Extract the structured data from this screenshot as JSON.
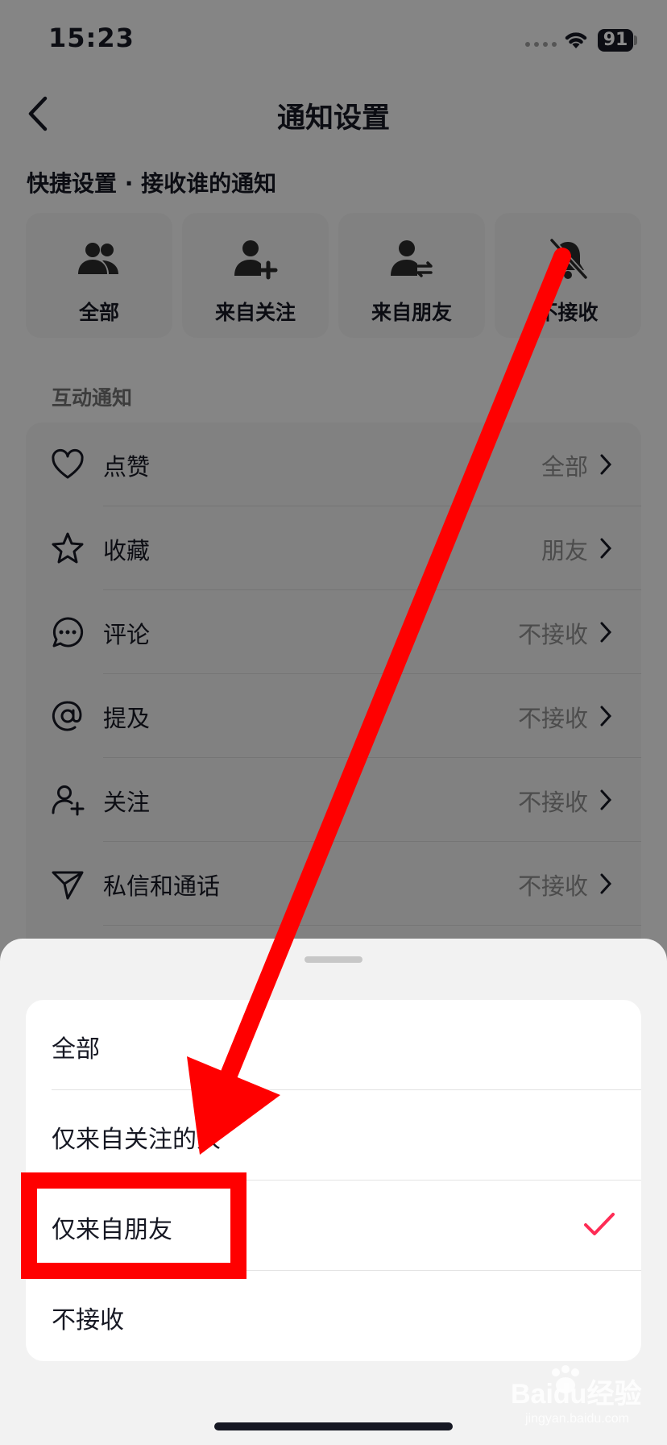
{
  "status": {
    "time": "15:23",
    "battery": "91"
  },
  "header": {
    "title": "通知设置"
  },
  "quick": {
    "title": "快捷设置 · 接收谁的通知",
    "cards": [
      {
        "label": "全部",
        "icon": "people-icon"
      },
      {
        "label": "来自关注",
        "icon": "person-add-icon"
      },
      {
        "label": "来自朋友",
        "icon": "person-swap-icon"
      },
      {
        "label": "不接收",
        "icon": "bell-off-icon"
      }
    ]
  },
  "interaction": {
    "title": "互动通知",
    "rows": [
      {
        "label": "点赞",
        "value": "全部",
        "icon": "heart-icon"
      },
      {
        "label": "收藏",
        "value": "朋友",
        "icon": "star-icon"
      },
      {
        "label": "评论",
        "value": "不接收",
        "icon": "comment-icon"
      },
      {
        "label": "提及",
        "value": "不接收",
        "icon": "at-icon"
      },
      {
        "label": "关注",
        "value": "不接收",
        "icon": "follow-icon"
      },
      {
        "label": "私信和通话",
        "value": "不接收",
        "icon": "send-icon"
      }
    ]
  },
  "sheet": {
    "options": [
      {
        "label": "全部"
      },
      {
        "label": "仅来自关注的人"
      },
      {
        "label": "仅来自朋友",
        "selected": true
      },
      {
        "label": "不接收"
      }
    ],
    "accent": "#fe2c55"
  },
  "annotation": {
    "color": "#ff0000"
  },
  "watermark": {
    "brand": "Baidu经验",
    "sub": "jingyan.baidu.com"
  }
}
